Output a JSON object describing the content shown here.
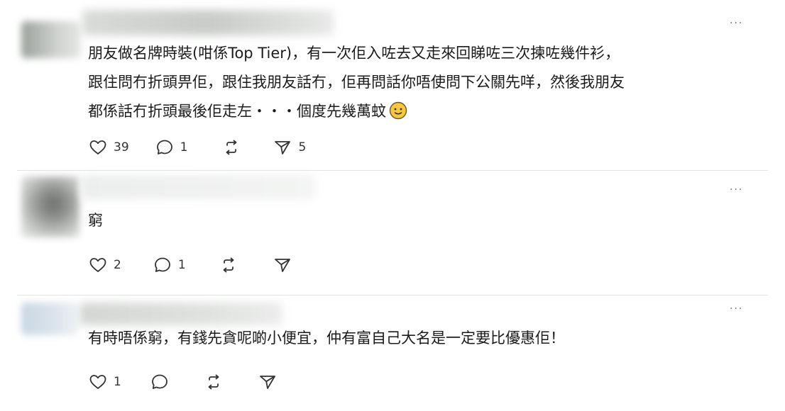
{
  "more_label": "···",
  "posts": [
    {
      "text_lines": [
        "朋友做名牌時裝(咁係Top Tier)，有一次佢入咗去又走來回睇咗三次揀咗幾件衫，",
        "跟住問冇折頭畀佢，跟住我朋友話冇，佢再問話你唔使問下公關先咩，然後我朋友",
        "都係話冇折頭最後佢走左・・・個度先幾萬蚊"
      ],
      "emoji": "slightly-smiling-face",
      "like_count": "39",
      "reply_count": "1",
      "repost_count": "",
      "share_count": "5"
    },
    {
      "text_lines": [
        "窮"
      ],
      "like_count": "2",
      "reply_count": "1",
      "repost_count": "",
      "share_count": ""
    },
    {
      "text_lines": [
        "有時唔係窮，有錢先貪呢啲小便宜，仲有富自己大名是一定要比優惠佢！"
      ],
      "like_count": "1",
      "reply_count": "",
      "repost_count": "",
      "share_count": ""
    }
  ],
  "icons": {
    "like": "heart-icon",
    "reply": "comment-bubble-icon",
    "repost": "repost-arrows-icon",
    "share": "send-icon",
    "more": "more-dots-icon"
  },
  "colors": {
    "text": "#1b1b1b",
    "icon": "#333333",
    "divider": "#e3e3e3"
  }
}
